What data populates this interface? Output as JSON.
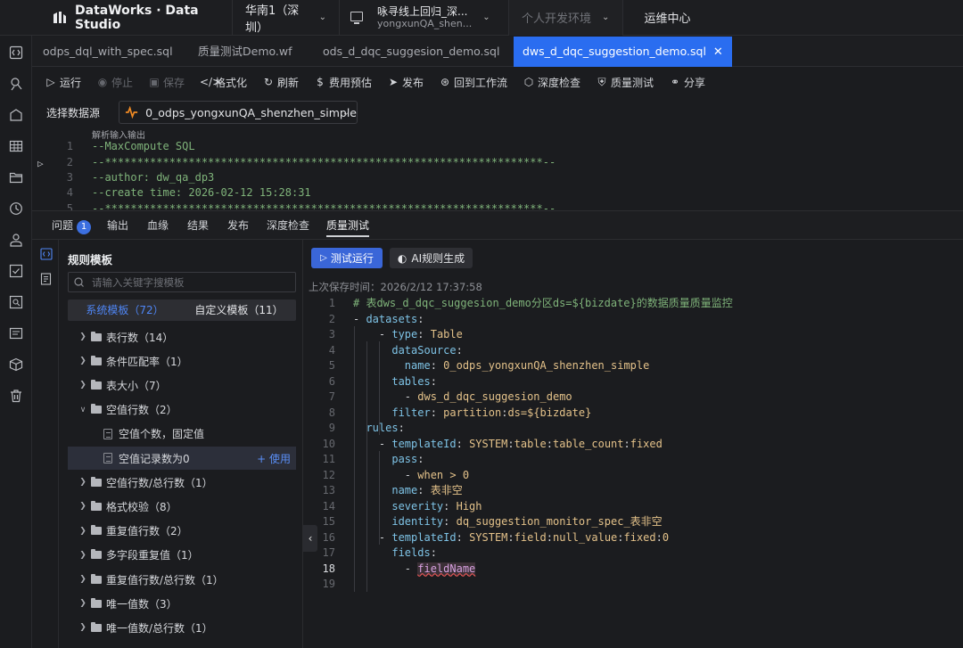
{
  "topbar": {
    "brand": "DataWorks · Data Studio",
    "region": "华南1（深圳）",
    "project_line1": "咏寻线上回归_深...",
    "project_line2": "yongxunQA_shen...",
    "env": "个人开发环境",
    "ops": "运维中心"
  },
  "rail_icons": [
    "code-icon",
    "search-person-icon",
    "box-icon",
    "table-icon",
    "folder-icon",
    "clock-icon",
    "user-icon",
    "checklist-icon",
    "search-doc-icon",
    "doc-icon",
    "package-icon",
    "trash-icon"
  ],
  "tabs": [
    {
      "label": "odps_dql_with_spec.sql"
    },
    {
      "label": "质量测试Demo.wf"
    },
    {
      "label": "ods_d_dqc_suggesion_demo.sql"
    },
    {
      "label": "dws_d_dqc_suggestion_demo.sql",
      "close": "✕"
    }
  ],
  "toolbar": {
    "run": "运行",
    "stop": "停止",
    "save": "保存",
    "format": "格式化",
    "refresh": "刷新",
    "cost": "费用预估",
    "publish": "发布",
    "back": "回到工作流",
    "deep_check": "深度检查",
    "quality_test": "质量测试",
    "share": "分享"
  },
  "datasource": {
    "label": "选择数据源",
    "value": "0_odps_yongxunQA_shenzhen_simple"
  },
  "editor": {
    "hint": "解析输入输出",
    "lines": [
      {
        "n": "1",
        "code": "--MaxCompute SQL"
      },
      {
        "n": "2",
        "code": "--********************************************************************--"
      },
      {
        "n": "3",
        "code": "--author: dw_qa_dp3"
      },
      {
        "n": "4",
        "code": "--create time: 2026-02-12 15:28:31"
      },
      {
        "n": "5",
        "code": "--********************************************************************--"
      }
    ]
  },
  "bottom_tabs": {
    "issues": "问题",
    "issues_count": "1",
    "output": "输出",
    "lineage": "血缘",
    "result": "结果",
    "publish": "发布",
    "deep_check": "深度检查",
    "quality_test": "质量测试"
  },
  "rules_panel": {
    "title": "规则模板",
    "search_placeholder": "请输入关键字搜模板",
    "system_tab": "系统模板（72）",
    "custom_tab": "自定义模板（11）",
    "use_label": "+ 使用",
    "items": [
      {
        "label": "表行数（14）",
        "type": "folder",
        "expanded": false
      },
      {
        "label": "条件匹配率（1）",
        "type": "folder",
        "expanded": false
      },
      {
        "label": "表大小（7）",
        "type": "folder",
        "expanded": false
      },
      {
        "label": "空值行数（2）",
        "type": "folder",
        "expanded": true
      },
      {
        "label": "空值个数，固定值",
        "type": "doc"
      },
      {
        "label": "空值记录数为0",
        "type": "doc",
        "selected": true
      },
      {
        "label": "空值行数/总行数（1）",
        "type": "folder",
        "expanded": false
      },
      {
        "label": "格式校验（8）",
        "type": "folder",
        "expanded": false
      },
      {
        "label": "重复值行数（2）",
        "type": "folder",
        "expanded": false
      },
      {
        "label": "多字段重复值（1）",
        "type": "folder",
        "expanded": false
      },
      {
        "label": "重复值行数/总行数（1）",
        "type": "folder",
        "expanded": false
      },
      {
        "label": "唯一值数（3）",
        "type": "folder",
        "expanded": false
      },
      {
        "label": "唯一值数/总行数（1）",
        "type": "folder",
        "expanded": false
      }
    ]
  },
  "quality_panel": {
    "test_run": "测试运行",
    "ai_gen": "AI规则生成",
    "save_time": "上次保存时间：2026/2/12 17:37:58",
    "current_line": "18",
    "lines": [
      {
        "n": "1",
        "parts": [
          [
            "c",
            "# 表dws_d_dqc_suggesion_demo分区ds=${bizdate}的数据质量质量监控"
          ]
        ]
      },
      {
        "n": "2",
        "parts": [
          [
            "p",
            "- "
          ],
          [
            "k",
            "datasets"
          ],
          [
            "p",
            ":"
          ]
        ]
      },
      {
        "n": "3",
        "parts": [
          [
            "p",
            "    - "
          ],
          [
            "k",
            "type"
          ],
          [
            "p",
            ": "
          ],
          [
            "v",
            "Table"
          ]
        ]
      },
      {
        "n": "4",
        "parts": [
          [
            "p",
            "      "
          ],
          [
            "k",
            "dataSource"
          ],
          [
            "p",
            ":"
          ]
        ]
      },
      {
        "n": "5",
        "parts": [
          [
            "p",
            "        "
          ],
          [
            "k",
            "name"
          ],
          [
            "p",
            ": "
          ],
          [
            "v",
            "0_odps_yongxunQA_shenzhen_simple"
          ]
        ]
      },
      {
        "n": "6",
        "parts": [
          [
            "p",
            "      "
          ],
          [
            "k",
            "tables"
          ],
          [
            "p",
            ":"
          ]
        ]
      },
      {
        "n": "7",
        "parts": [
          [
            "p",
            "        - "
          ],
          [
            "v",
            "dws_d_dqc_suggesion_demo"
          ]
        ]
      },
      {
        "n": "8",
        "parts": [
          [
            "p",
            "      "
          ],
          [
            "k",
            "filter"
          ],
          [
            "p",
            ": "
          ],
          [
            "v",
            "partition"
          ],
          [
            "p",
            ":"
          ],
          [
            "v",
            "ds=${bizdate}"
          ]
        ]
      },
      {
        "n": "9",
        "parts": [
          [
            "p",
            "  "
          ],
          [
            "k",
            "rules"
          ],
          [
            "p",
            ":"
          ]
        ]
      },
      {
        "n": "10",
        "parts": [
          [
            "p",
            "    - "
          ],
          [
            "k",
            "templateId"
          ],
          [
            "p",
            ": "
          ],
          [
            "v",
            "SYSTEM"
          ],
          [
            "p",
            ":"
          ],
          [
            "v",
            "table"
          ],
          [
            "p",
            ":"
          ],
          [
            "v",
            "table_count"
          ],
          [
            "p",
            ":"
          ],
          [
            "v",
            "fixed"
          ]
        ]
      },
      {
        "n": "11",
        "parts": [
          [
            "p",
            "      "
          ],
          [
            "k",
            "pass"
          ],
          [
            "p",
            ":"
          ]
        ]
      },
      {
        "n": "12",
        "parts": [
          [
            "p",
            "        - "
          ],
          [
            "v",
            "when > 0"
          ]
        ]
      },
      {
        "n": "13",
        "parts": [
          [
            "p",
            "      "
          ],
          [
            "k",
            "name"
          ],
          [
            "p",
            ": "
          ],
          [
            "v",
            "表非空"
          ]
        ]
      },
      {
        "n": "14",
        "parts": [
          [
            "p",
            "      "
          ],
          [
            "k",
            "severity"
          ],
          [
            "p",
            ": "
          ],
          [
            "v",
            "High"
          ]
        ]
      },
      {
        "n": "15",
        "parts": [
          [
            "p",
            "      "
          ],
          [
            "k",
            "identity"
          ],
          [
            "p",
            ": "
          ],
          [
            "v",
            "dq_suggestion_monitor_spec_表非空"
          ]
        ]
      },
      {
        "n": "16",
        "parts": [
          [
            "p",
            "    - "
          ],
          [
            "k",
            "templateId"
          ],
          [
            "p",
            ": "
          ],
          [
            "v",
            "SYSTEM"
          ],
          [
            "p",
            ":"
          ],
          [
            "v",
            "field"
          ],
          [
            "p",
            ":"
          ],
          [
            "v",
            "null_value"
          ],
          [
            "p",
            ":"
          ],
          [
            "v",
            "fixed"
          ],
          [
            "p",
            ":"
          ],
          [
            "v",
            "0"
          ]
        ]
      },
      {
        "n": "17",
        "parts": [
          [
            "p",
            "      "
          ],
          [
            "k",
            "fields"
          ],
          [
            "p",
            ":"
          ]
        ]
      },
      {
        "n": "18",
        "parts": [
          [
            "p",
            "        - "
          ],
          [
            "sq",
            "fieldName"
          ]
        ]
      },
      {
        "n": "19",
        "parts": []
      }
    ]
  },
  "colors": {
    "accent": "#2a6df0",
    "primary_button": "#3a66d8",
    "key": "#7ec3e6",
    "value": "#e4c28a",
    "comment": "#7fb37a"
  }
}
